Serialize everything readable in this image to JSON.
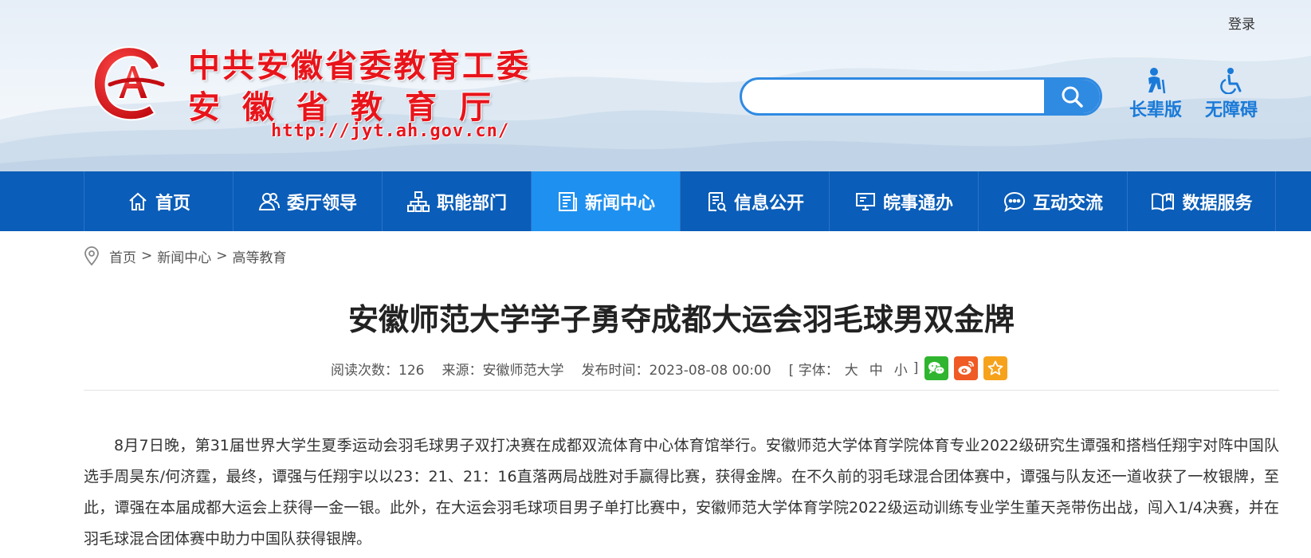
{
  "header": {
    "login": "登录",
    "org_line1": "中共安徽省委教育工委",
    "org_line2": "安徽省教育厅",
    "url": "http://jyt.ah.gov.cn/",
    "search_placeholder": "",
    "elder_mode": "长辈版",
    "accessibility": "无障碍"
  },
  "nav": {
    "items": [
      {
        "label": "首页",
        "icon": "home-icon"
      },
      {
        "label": "委厅领导",
        "icon": "leaders-icon"
      },
      {
        "label": "职能部门",
        "icon": "org-chart-icon"
      },
      {
        "label": "新闻中心",
        "icon": "news-icon",
        "active": true
      },
      {
        "label": "信息公开",
        "icon": "document-list-icon"
      },
      {
        "label": "皖事通办",
        "icon": "monitor-icon"
      },
      {
        "label": "互动交流",
        "icon": "chat-icon"
      },
      {
        "label": "数据服务",
        "icon": "book-icon"
      }
    ]
  },
  "breadcrumb": {
    "items": [
      "首页",
      "新闻中心",
      "高等教育"
    ],
    "separator": ">"
  },
  "article": {
    "title": "安徽师范大学学子勇夺成都大运会羽毛球男双金牌",
    "views": "阅读次数：126",
    "source": "来源：安徽师范大学",
    "published": "发布时间：2023-08-08 00:00",
    "font_label_open": "[ 字体：",
    "font_large": "大",
    "font_medium": "中",
    "font_small": "小",
    "font_label_close": "]",
    "body": "8月7日晚，第31届世界大学生夏季运动会羽毛球男子双打决赛在成都双流体育中心体育馆举行。安徽师范大学体育学院体育专业2022级研究生谭强和搭档任翔宇对阵中国队选手周昊东/何济霆，最终，谭强与任翔宇以以23：21、21：16直落两局战胜对手赢得比赛，获得金牌。在不久前的羽毛球混合团体赛中，谭强与队友还一道收获了一枚银牌，至此，谭强在本届成都大运会上获得一金一银。此外，在大运会羽毛球项目男子单打比赛中，安徽师范大学体育学院2022级运动训练专业学生董天尧带伤出战，闯入1/4决赛，并在羽毛球混合团体赛中助力中国队获得银牌。"
  },
  "share": [
    {
      "icon": "wechat-icon",
      "color": "#2fb52f"
    },
    {
      "icon": "weibo-icon",
      "color": "#f05a24"
    },
    {
      "icon": "favorite-star-icon",
      "color": "#f7a21b"
    }
  ],
  "colors": {
    "nav_bg": "#0a5db8",
    "nav_active": "#1e90f0",
    "logo_red": "#e8141b",
    "accent_blue": "#2f8ae2"
  }
}
